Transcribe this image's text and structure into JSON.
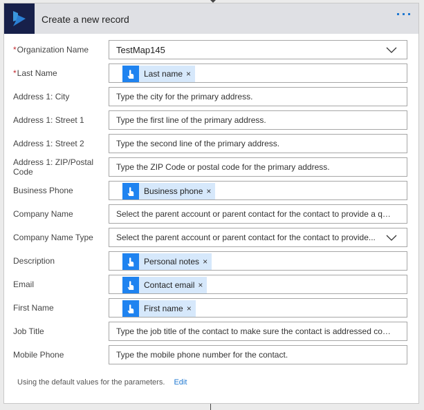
{
  "card": {
    "title": "Create a new record",
    "logo_icon": "dynamics-logo-icon",
    "more_icon": "ellipsis-icon"
  },
  "fields": [
    {
      "label": "Organization Name",
      "required": true,
      "type": "select",
      "value": "TestMap145",
      "placeholder": ""
    },
    {
      "label": "Last Name",
      "required": true,
      "type": "token",
      "token": "Last name"
    },
    {
      "label": "Address 1: City",
      "required": false,
      "type": "text",
      "placeholder": "Type the city for the primary address."
    },
    {
      "label": "Address 1: Street 1",
      "required": false,
      "type": "text",
      "placeholder": "Type the first line of the primary address."
    },
    {
      "label": "Address 1: Street 2",
      "required": false,
      "type": "text",
      "placeholder": "Type the second line of the primary address."
    },
    {
      "label": "Address 1: ZIP/Postal Code",
      "required": false,
      "type": "text",
      "placeholder": "Type the ZIP Code or postal code for the primary address."
    },
    {
      "label": "Business Phone",
      "required": false,
      "type": "token",
      "token": "Business phone"
    },
    {
      "label": "Company Name",
      "required": false,
      "type": "text",
      "placeholder": "Select the parent account or parent contact for the contact to provide a quic..."
    },
    {
      "label": "Company Name Type",
      "required": false,
      "type": "select",
      "placeholder": "Select the parent account or parent contact for the contact to provide...",
      "value": ""
    },
    {
      "label": "Description",
      "required": false,
      "type": "token",
      "token": "Personal notes"
    },
    {
      "label": "Email",
      "required": false,
      "type": "token",
      "token": "Contact email"
    },
    {
      "label": "First Name",
      "required": false,
      "type": "token",
      "token": "First name"
    },
    {
      "label": "Job Title",
      "required": false,
      "type": "text",
      "placeholder": "Type the job title of the contact to make sure the contact is addressed correc..."
    },
    {
      "label": "Mobile Phone",
      "required": false,
      "type": "text",
      "placeholder": "Type the mobile phone number for the contact."
    }
  ],
  "token_icon": "dynamic-content-hand-icon",
  "remove_glyph": "×",
  "required_mark": "*",
  "footer": {
    "text": "Using the default values for the parameters.",
    "edit_label": "Edit"
  }
}
